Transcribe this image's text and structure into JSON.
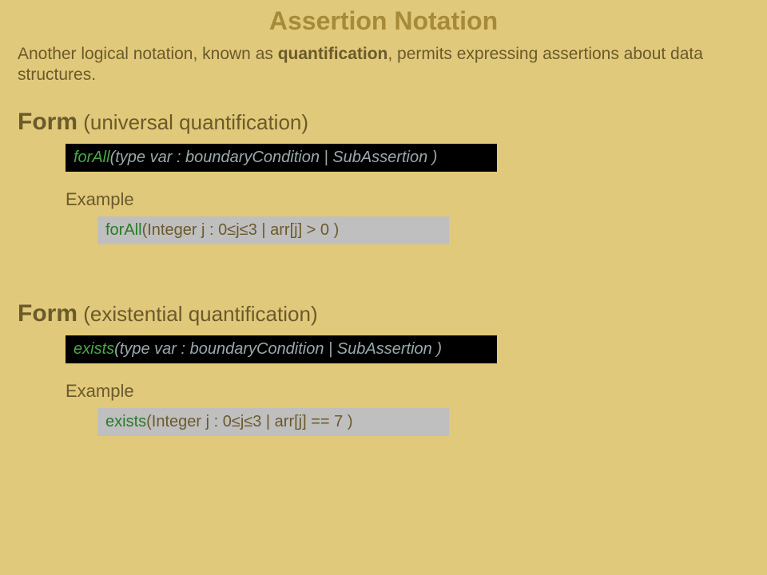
{
  "title": "Assertion Notation",
  "intro_pre": "Another logical notation, known as ",
  "intro_bold": "quantification",
  "intro_post": ", permits expressing assertions about data structures.",
  "universal": {
    "form_word": "Form",
    "form_paren": " (universal quantification)",
    "kw": "forAll",
    "syntax_rest": "(type  var : boundaryCondition   |   SubAssertion )",
    "example_label": "Example",
    "example_rest": "(Integer j : 0≤j≤3  |  arr[j] > 0 )"
  },
  "existential": {
    "form_word": "Form",
    "form_paren": " (existential quantification)",
    "kw": "exists",
    "syntax_rest": "(type  var : boundaryCondition   |   SubAssertion )",
    "example_label": "Example",
    "example_rest": "(Integer j : 0≤j≤3  |  arr[j] == 7 )"
  }
}
